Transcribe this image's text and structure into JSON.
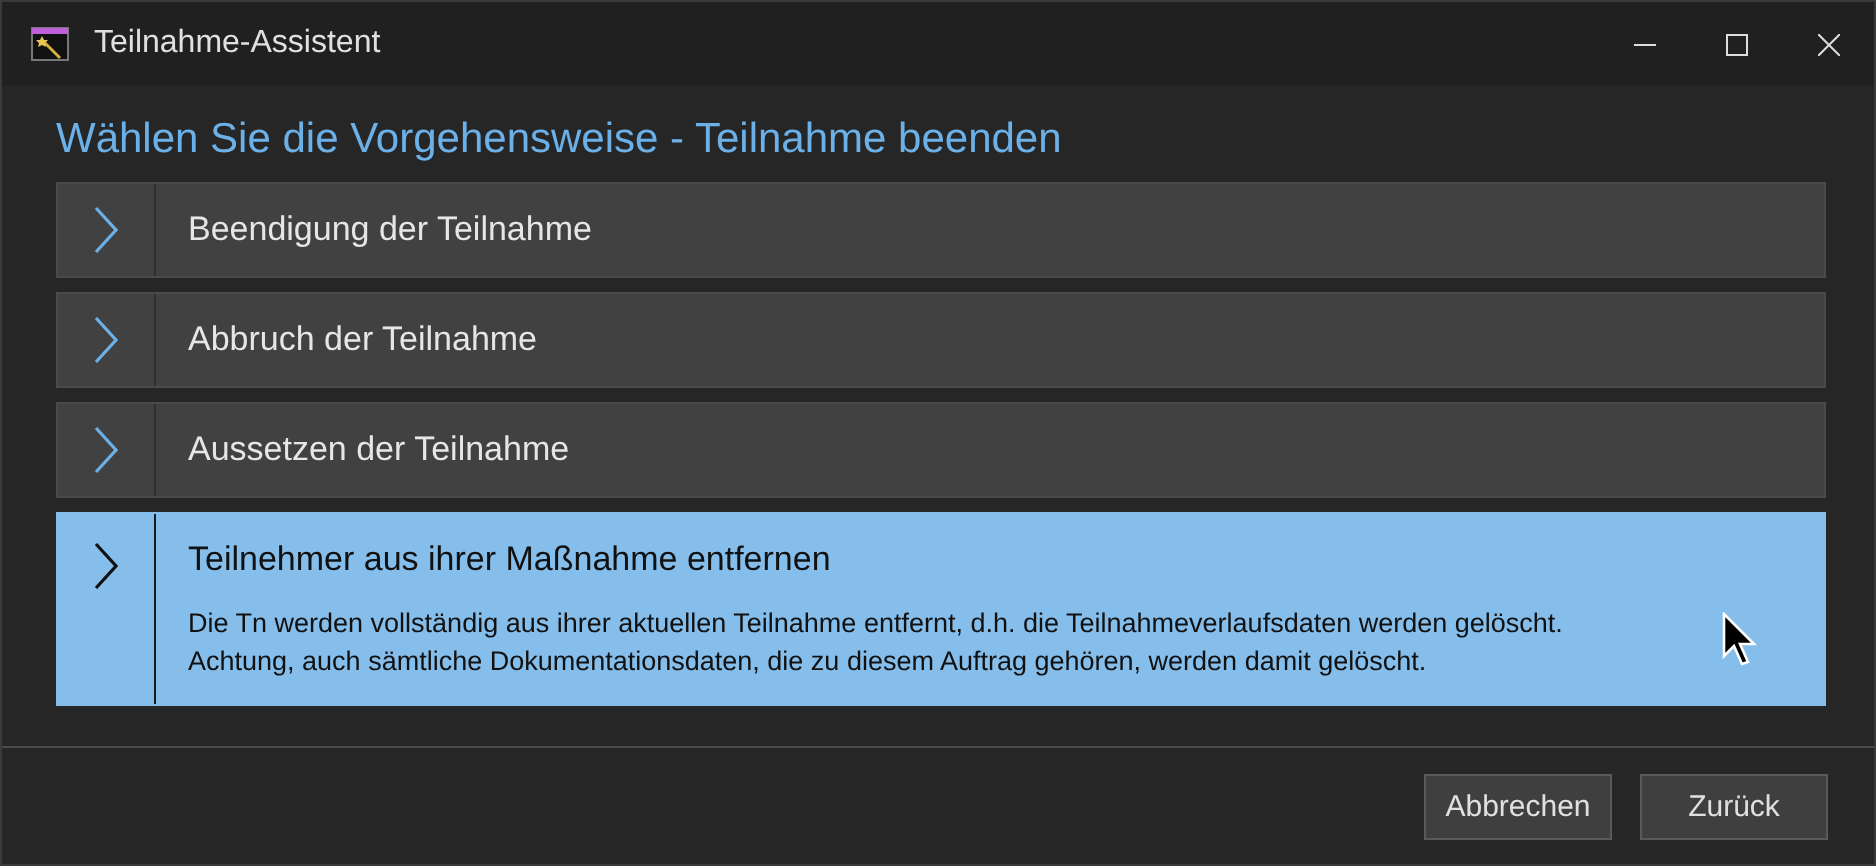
{
  "window": {
    "title": "Teilnahme-Assistent"
  },
  "heading": "Wählen Sie die Vorgehensweise - Teilnahme beenden",
  "options": [
    {
      "label": "Beendigung der Teilnahme",
      "selected": false
    },
    {
      "label": "Abbruch der Teilnahme",
      "selected": false
    },
    {
      "label": "Aussetzen der Teilnahme",
      "selected": false
    },
    {
      "label": "Teilnehmer aus ihrer Maßnahme entfernen",
      "selected": true,
      "description": "Die Tn werden vollständig aus ihrer aktuellen Teilnahme entfernt, d.h. die Teilnahmeverlaufsdaten werden gelöscht.\nAchtung, auch sämtliche Dokumentationsdaten, die zu diesem Auftrag gehören, werden damit gelöscht."
    }
  ],
  "buttons": [
    "Abbrechen",
    "Zurück"
  ]
}
